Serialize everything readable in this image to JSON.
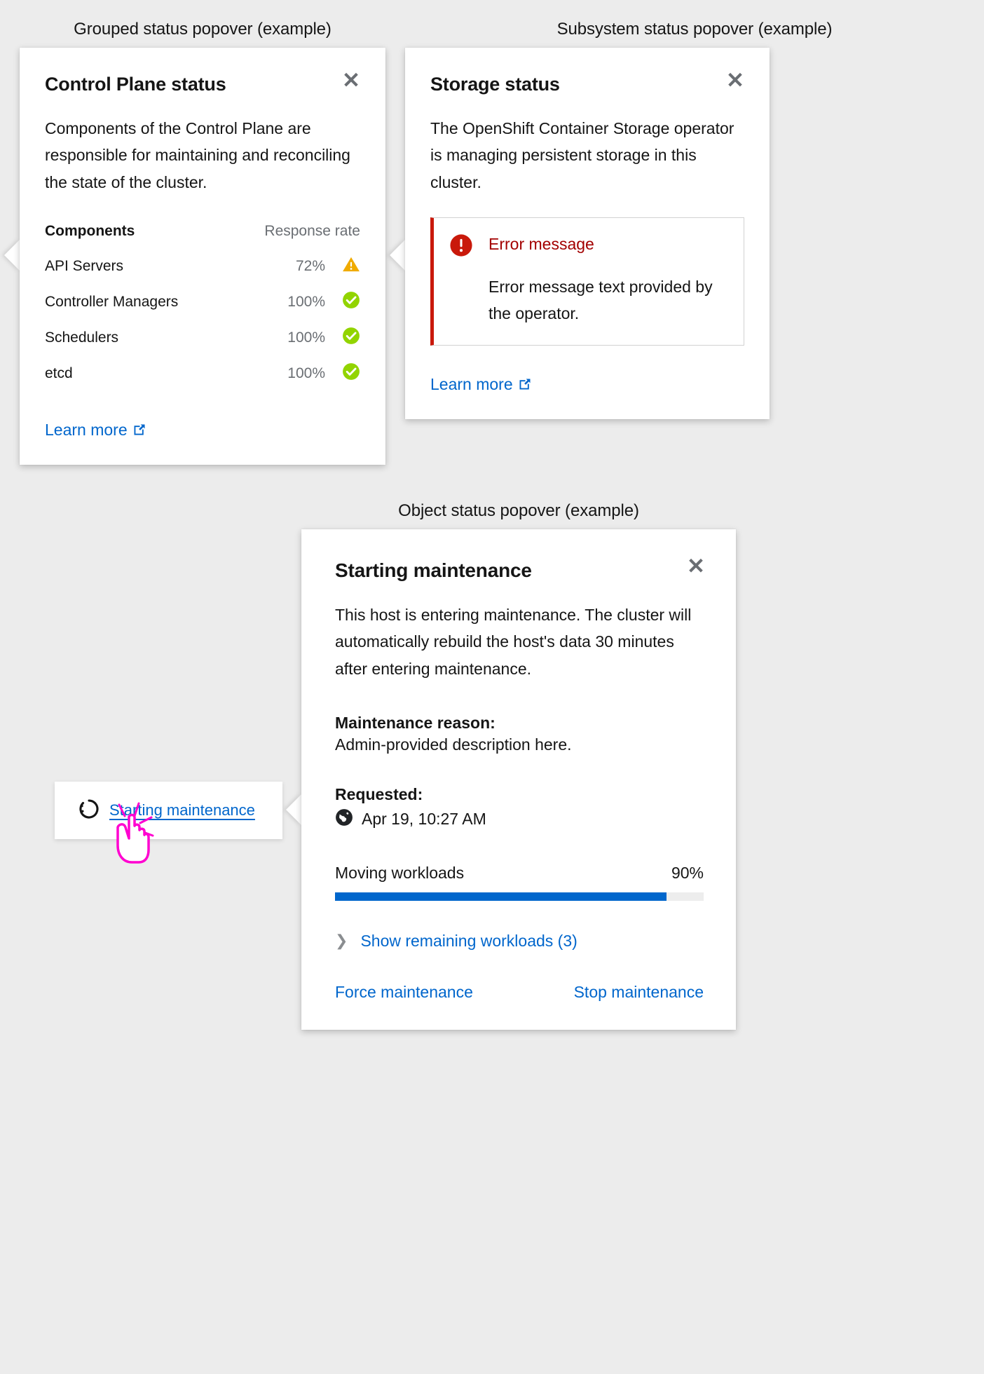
{
  "captions": {
    "grouped": "Grouped status popover (example)",
    "subsystem": "Subsystem status popover (example)",
    "object": "Object status popover (example)"
  },
  "colors": {
    "link": "#0066CC",
    "danger": "#C9190B",
    "danger_text": "#A30000",
    "warning": "#F0AB00",
    "success": "#92D400",
    "progress": "#0066CC",
    "page_background": "#ECECEC"
  },
  "control_plane_popover": {
    "title": "Control Plane status",
    "close_label": "✕",
    "body": "Components of the Control Plane are responsible for maintaining and reconciling the state of the cluster.",
    "table": {
      "headers": [
        "Components",
        "Response rate"
      ],
      "rows": [
        {
          "component": "API Servers",
          "rate": "72%",
          "status": "warning"
        },
        {
          "component": "Controller Managers",
          "rate": "100%",
          "status": "success"
        },
        {
          "component": "Schedulers",
          "rate": "100%",
          "status": "success"
        },
        {
          "component": "etcd",
          "rate": "100%",
          "status": "success"
        }
      ]
    },
    "learn_more": "Learn more"
  },
  "storage_popover": {
    "title": "Storage status",
    "close_label": "✕",
    "body": "The OpenShift Container Storage operator is managing persistent storage in this cluster.",
    "alert": {
      "title": "Error message",
      "text": "Error message text provided by the operator.",
      "icon": "error-circle-icon"
    },
    "learn_more": "Learn more"
  },
  "maintenance_popover": {
    "title": "Starting maintenance",
    "close_label": "✕",
    "body": "This host is entering maintenance. The cluster will automatically rebuild the host's data 30 minutes after entering maintenance.",
    "reason_label": "Maintenance reason:",
    "reason_value": "Admin-provided description here.",
    "requested_label": "Requested:",
    "requested_value": "Apr 19, 10:27 AM",
    "requested_icon": "globe-icon",
    "progress": {
      "label": "Moving workloads",
      "percent_label": "90%",
      "percent": 90
    },
    "expand_label": "Show remaining workloads (3)",
    "actions": {
      "force": "Force maintenance",
      "stop": "Stop maintenance"
    }
  },
  "trigger": {
    "label": "Starting maintenance",
    "spinner_icon": "in-progress-icon",
    "cursor_icon": "pointer-hand-cursor"
  }
}
